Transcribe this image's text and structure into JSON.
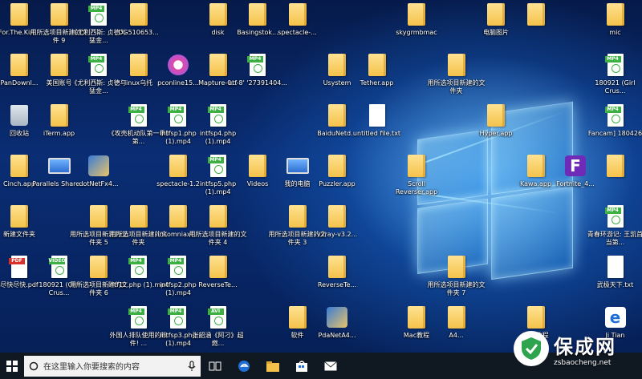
{
  "desktop": {
    "icons": [
      {
        "label": "For.The.Kin...",
        "type": "folder",
        "col": 0,
        "row": 0
      },
      {
        "label": "用所选项目新建的文件 9",
        "type": "folder",
        "col": 1,
        "row": 0
      },
      {
        "label": "《尤利西斯: 贞德与猛金...",
        "type": "mp4",
        "col": 2,
        "row": 0
      },
      {
        "label": "DG510653...",
        "type": "folder",
        "col": 3,
        "row": 0
      },
      {
        "label": "disk",
        "type": "folder",
        "col": 5,
        "row": 0
      },
      {
        "label": "Basingstok...",
        "type": "folder",
        "col": 6,
        "row": 0
      },
      {
        "label": "spectacle-...",
        "type": "folder",
        "col": 7,
        "row": 0
      },
      {
        "label": "skygrmbmac",
        "type": "folder",
        "col": 10,
        "row": 0
      },
      {
        "label": "电脑图片",
        "type": "folder",
        "col": 12,
        "row": 0
      },
      {
        "label": "",
        "type": "folder",
        "col": 13,
        "row": 0
      },
      {
        "label": "mic",
        "type": "folder",
        "col": 15,
        "row": 0
      },
      {
        "label": "PanDownl...",
        "type": "folder",
        "col": 0,
        "row": 1
      },
      {
        "label": "美国账号",
        "type": "folder",
        "col": 1,
        "row": 1
      },
      {
        "label": "《尤利西斯: 贞德与猛金...",
        "type": "mp4",
        "col": 2,
        "row": 1
      },
      {
        "label": "linux乌托",
        "type": "folder",
        "col": 3,
        "row": 1
      },
      {
        "label": "pconline15...",
        "type": "itunes",
        "col": 4,
        "row": 1
      },
      {
        "label": "Mapture-0...",
        "type": "folder",
        "col": 5,
        "row": 1
      },
      {
        "label": "utf-8' '27391404...",
        "type": "mp4",
        "col": 6,
        "row": 1
      },
      {
        "label": "Usystem",
        "type": "folder",
        "col": 8,
        "row": 1
      },
      {
        "label": "Tether.app",
        "type": "folder",
        "col": 9,
        "row": 1
      },
      {
        "label": "用所选项目新建的文件夹",
        "type": "folder",
        "col": 11,
        "row": 1
      },
      {
        "label": "180921 (Girl Crus...",
        "type": "mp4",
        "col": 15,
        "row": 1
      },
      {
        "label": "回收站",
        "type": "recycle",
        "col": 0,
        "row": 2
      },
      {
        "label": "iTerm.app",
        "type": "folder",
        "col": 1,
        "row": 2
      },
      {
        "label": "《攻壳机动队第一季》第...",
        "type": "mp4",
        "col": 3,
        "row": 2
      },
      {
        "label": "intfsp1.php (1).mp4",
        "type": "mp4",
        "col": 4,
        "row": 2
      },
      {
        "label": "intfsp4.php (1).mp4",
        "type": "mp4",
        "col": 5,
        "row": 2
      },
      {
        "label": "BaiduNetd...",
        "type": "folder",
        "col": 8,
        "row": 2
      },
      {
        "label": "untitled file.txt",
        "type": "blank",
        "col": 9,
        "row": 2
      },
      {
        "label": "Hyper.app",
        "type": "folder",
        "col": 12,
        "row": 2
      },
      {
        "label": "Fancam] 180426",
        "type": "mp4",
        "col": 15,
        "row": 2
      },
      {
        "label": "Cinch.app",
        "type": "folder",
        "col": 0,
        "row": 3
      },
      {
        "label": "Parallels Share...",
        "type": "monitor",
        "col": 1,
        "row": 3
      },
      {
        "label": "dotNetFx4...",
        "type": "setup",
        "col": 2,
        "row": 3
      },
      {
        "label": "spectacle-1.2",
        "type": "folder",
        "col": 4,
        "row": 3
      },
      {
        "label": "intfsp5.php (1).mp4",
        "type": "mp4",
        "col": 5,
        "row": 3
      },
      {
        "label": "Videos",
        "type": "folder",
        "col": 6,
        "row": 3
      },
      {
        "label": "我的电脑",
        "type": "monitor",
        "col": 7,
        "row": 3
      },
      {
        "label": "Puzzler.app",
        "type": "folder",
        "col": 8,
        "row": 3
      },
      {
        "label": "Scroll Reverser.app",
        "type": "folder",
        "col": 10,
        "row": 3
      },
      {
        "label": "Kawa.app",
        "type": "folder",
        "col": 13,
        "row": 3
      },
      {
        "label": "Fortnite_4...",
        "type": "fortnite",
        "col": 14,
        "row": 3
      },
      {
        "label": "",
        "type": "folder",
        "col": 15,
        "row": 3
      },
      {
        "label": "新建文件夹",
        "type": "folder",
        "col": 0,
        "row": 4
      },
      {
        "label": "用所选项目新建的文件夹 5",
        "type": "folder",
        "col": 2,
        "row": 4
      },
      {
        "label": "用所选项目新建的文件夹",
        "type": "folder",
        "col": 3,
        "row": 4
      },
      {
        "label": "insomniaxf...",
        "type": "folder",
        "col": 4,
        "row": 4
      },
      {
        "label": "用所选项目新建的文件夹 4",
        "type": "folder",
        "col": 5,
        "row": 4
      },
      {
        "label": "用所选项目新建的文件夹 3",
        "type": "folder",
        "col": 7,
        "row": 4
      },
      {
        "label": "v2ray-v3.2...",
        "type": "folder",
        "col": 8,
        "row": 4
      },
      {
        "label": "青春环游记: 王凯首当第...",
        "type": "mp4",
        "col": 15,
        "row": 4
      },
      {
        "label": "尽快尽快.pdf",
        "type": "pdf",
        "col": 0,
        "row": 5
      },
      {
        "label": "180921 (Girl Crus...",
        "type": "video",
        "col": 1,
        "row": 5
      },
      {
        "label": "用所选项目新建的文件夹 6",
        "type": "folder",
        "col": 2,
        "row": 5
      },
      {
        "label": "intf12.php (1).mp4",
        "type": "mp4",
        "col": 3,
        "row": 5
      },
      {
        "label": "intfsp2.php (1).mp4",
        "type": "mp4",
        "col": 4,
        "row": 5
      },
      {
        "label": "ReverseTe...",
        "type": "folder",
        "col": 5,
        "row": 5
      },
      {
        "label": "ReverseTe...",
        "type": "folder",
        "col": 8,
        "row": 5
      },
      {
        "label": "用所选项目新建的文件夹 7",
        "type": "folder",
        "col": 11,
        "row": 5
      },
      {
        "label": "武极天下.txt",
        "type": "blank",
        "col": 15,
        "row": 5
      },
      {
        "label": "外国人排队使用的软件! ...",
        "type": "mp4",
        "col": 3,
        "row": 6
      },
      {
        "label": "intfsp3.php (1).mp4",
        "type": "mp4",
        "col": 4,
        "row": 6
      },
      {
        "label": "张韶涵《阿刁》超燃...",
        "type": "avi",
        "col": 5,
        "row": 6
      },
      {
        "label": "软件",
        "type": "folder",
        "col": 7,
        "row": 6
      },
      {
        "label": "PdaNetA4...",
        "type": "setup",
        "col": 8,
        "row": 6
      },
      {
        "label": "Mac教程",
        "type": "folder",
        "col": 10,
        "row": 6
      },
      {
        "label": "A4...",
        "type": "folder",
        "col": 11,
        "row": 6
      },
      {
        "label": "Mac教程",
        "type": "folder",
        "col": 13,
        "row": 6
      },
      {
        "label": "Ji Tian",
        "type": "edge-app",
        "col": 15,
        "row": 6
      }
    ]
  },
  "taskbar": {
    "search_placeholder": "在这里输入你要搜索的内容",
    "icons": [
      "windows-start-icon",
      "microphone-icon",
      "task-view-icon",
      "edge-icon",
      "explorer-icon",
      "store-icon",
      "mail-icon"
    ]
  },
  "watermark": {
    "name": "保成网",
    "domain": "zsbaocheng.net"
  }
}
